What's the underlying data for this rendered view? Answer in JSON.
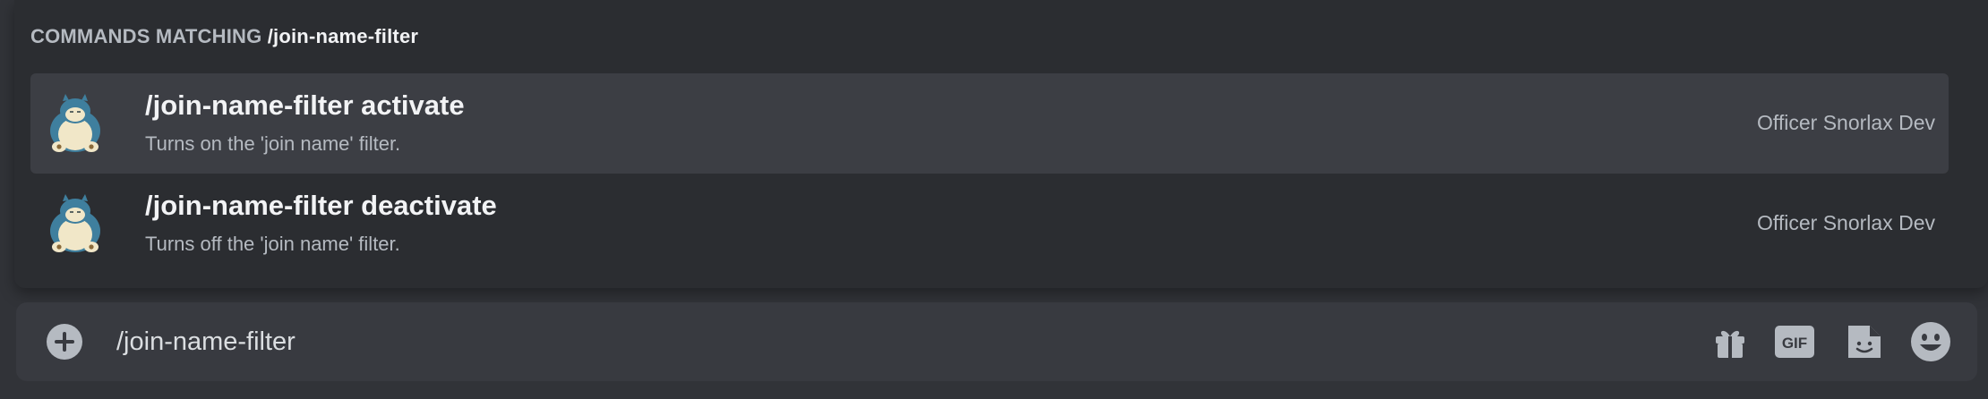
{
  "autocomplete": {
    "header_prefix": "COMMANDS MATCHING",
    "header_query": "/join-name-filter",
    "commands": [
      {
        "name": "/join-name-filter activate",
        "description": "Turns on the 'join name' filter.",
        "source": "Officer Snorlax Dev",
        "avatar_icon": "snorlax-avatar-icon",
        "selected": true
      },
      {
        "name": "/join-name-filter deactivate",
        "description": "Turns off the 'join name' filter.",
        "source": "Officer Snorlax Dev",
        "avatar_icon": "snorlax-avatar-icon",
        "selected": false
      }
    ]
  },
  "composer": {
    "value": "/join-name-filter",
    "buttons": [
      "plus-circle-icon",
      "gift-icon",
      "gif-icon",
      "sticker-icon",
      "emoji-icon"
    ],
    "gif_label": "GIF"
  },
  "colors": {
    "background": "#313338",
    "popup": "#2b2d31",
    "selected_row": "#3c3e44",
    "composer": "#383a40",
    "text_primary": "#f2f3f5",
    "text_muted": "#b5bac1"
  }
}
